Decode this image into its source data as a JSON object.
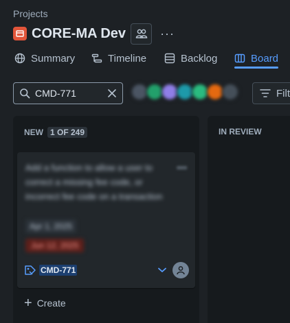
{
  "breadcrumb": "Projects",
  "project": {
    "title": "CORE-MA Dev",
    "icon": "project-icon",
    "icon_color": "#e2553a"
  },
  "header_actions": {
    "people_icon": "people-icon",
    "more_label": "···"
  },
  "tabs": [
    {
      "label": "Summary",
      "icon": "globe-icon",
      "active": false
    },
    {
      "label": "Timeline",
      "icon": "timeline-icon",
      "active": false
    },
    {
      "label": "Backlog",
      "icon": "backlog-icon",
      "active": false
    },
    {
      "label": "Board",
      "icon": "board-icon",
      "active": true
    }
  ],
  "search": {
    "value": "CMD-771",
    "placeholder": ""
  },
  "filter": {
    "label": "Filte"
  },
  "avatar_colors": [
    "#4b5563",
    "#22a06b",
    "#8f7ee7",
    "#1d9aaa",
    "#2abb7f",
    "#e56910",
    "#454f59"
  ],
  "columns": [
    {
      "title": "NEW",
      "count": "1 OF 249",
      "cards": [
        {
          "key": "CMD-771",
          "text": "Add a function to allow a user to correct a missing fee code, or incorrect fee code on a transaction",
          "date_label": "Apr 1, 2025",
          "due_label": "Jun 12, 2025",
          "priority": "low"
        }
      ],
      "create_label": "Create"
    },
    {
      "title": "IN REVIEW",
      "count": "",
      "cards": []
    }
  ],
  "colors": {
    "accent": "#579dff",
    "background": "#1d2125",
    "column": "#161a1d",
    "card": "#22272b"
  }
}
